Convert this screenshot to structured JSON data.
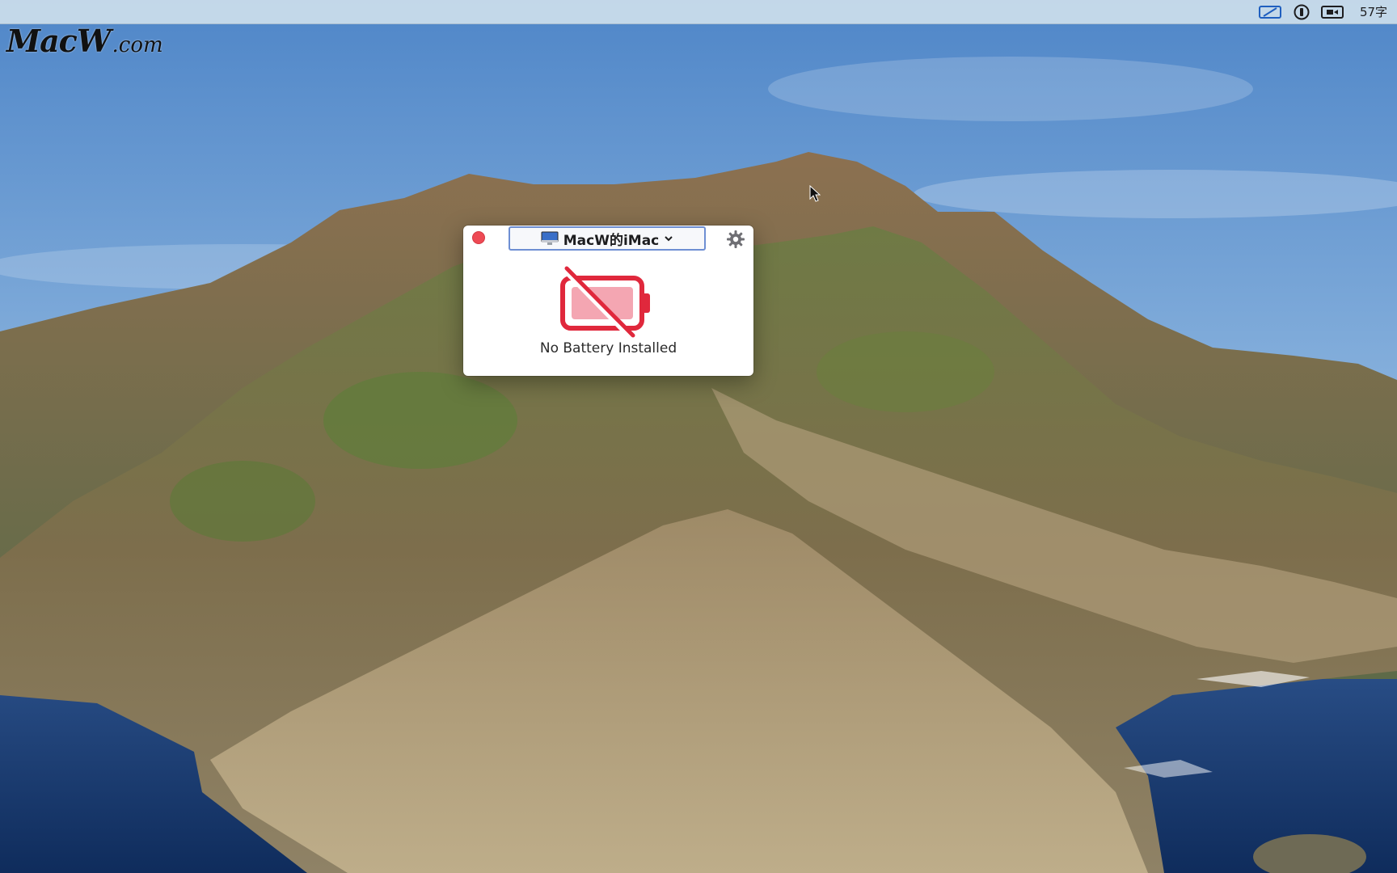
{
  "menubar": {
    "icons": [
      "input-source-icon",
      "one-password-icon",
      "screen-record-icon"
    ],
    "word_count": "57字"
  },
  "watermark": {
    "main": "MacW",
    "domain": ".com"
  },
  "popup": {
    "device_name": "MacW的iMac",
    "device_icon": "imac-icon",
    "dropdown_icon": "chevron-down-icon",
    "settings_icon": "gear-icon",
    "close_color": "#ee4a54",
    "battery_icon": "battery-disabled-icon",
    "battery_status": "No Battery Installed",
    "accent_color": "#e0283c"
  }
}
